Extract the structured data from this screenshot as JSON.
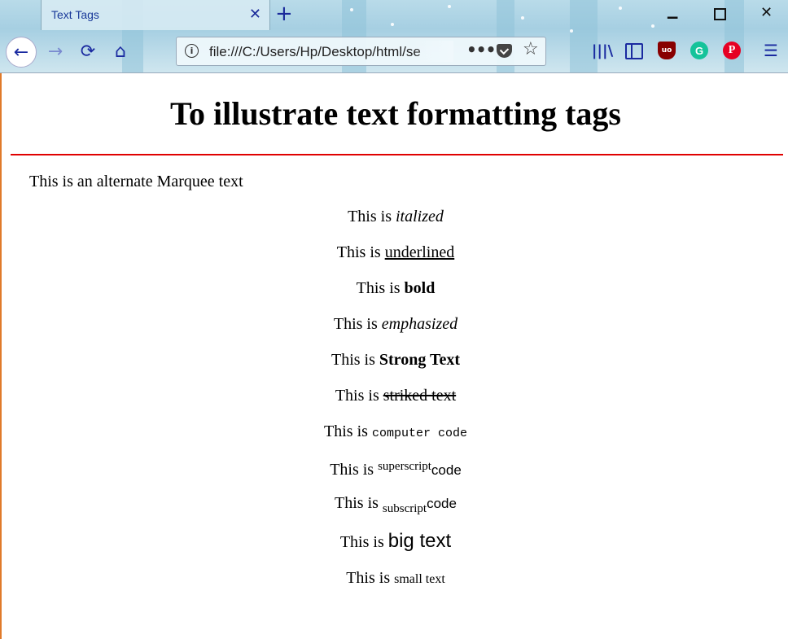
{
  "browser": {
    "tab_title": "Text Tags",
    "tab_close": "✕",
    "new_tab": "+",
    "url": "file:///C:/Users/Hp/Desktop/html/se",
    "url_more": "•••"
  },
  "page": {
    "heading": "To illustrate text formatting tags",
    "marquee_text": "This is an alternate Marquee text",
    "line_prefix": "This is",
    "italic": "italized",
    "underline": "underlined",
    "bold": "bold",
    "emphasized": "emphasized",
    "strong": "Strong Text",
    "striked": "striked text",
    "computer_code": "computer code",
    "superscript": "superscript",
    "subscript": "subscript",
    "code_word": "code",
    "big_text": "big text",
    "small_text": "small text"
  },
  "colors": {
    "rule": "#e00000",
    "accent": "#1a2aa0",
    "page_border": "#e07a2a"
  },
  "icons": [
    "back-icon",
    "forward-icon",
    "reload-icon",
    "home-icon",
    "info-icon",
    "page-actions-icon",
    "pocket-icon",
    "bookmark-star-icon",
    "library-icon",
    "sidebar-icon",
    "ublock-icon",
    "grammarly-icon",
    "pinterest-icon",
    "menu-icon"
  ]
}
